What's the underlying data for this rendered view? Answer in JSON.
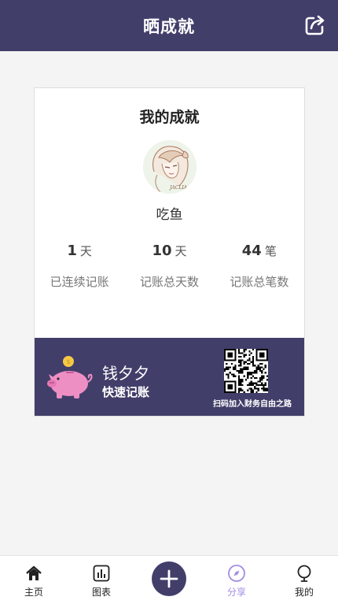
{
  "header": {
    "title": "晒成就",
    "share_icon": "share-icon"
  },
  "card": {
    "title": "我的成就",
    "username": "吃鱼",
    "stats": [
      {
        "value": "1",
        "unit": "天",
        "label": "已连续记账"
      },
      {
        "value": "10",
        "unit": "天",
        "label": "记账总天数"
      },
      {
        "value": "44",
        "unit": "笔",
        "label": "记账总笔数"
      }
    ]
  },
  "promo": {
    "brand_name": "钱夕夕",
    "slogan": "快速记账",
    "qr_caption": "扫码加入财务自由之路",
    "avatar_signature": "JACLIA"
  },
  "tabbar": {
    "items": [
      {
        "label": "主页",
        "icon": "home-icon"
      },
      {
        "label": "图表",
        "icon": "chart-icon"
      },
      {
        "label": "",
        "icon": "plus-icon"
      },
      {
        "label": "分享",
        "icon": "compass-icon"
      },
      {
        "label": "我的",
        "icon": "user-icon"
      }
    ],
    "active_index": 3
  },
  "colors": {
    "primary": "#423e6a",
    "active_tab": "#a38de2",
    "background": "#f4f4f4",
    "pig": "#ee8fc4",
    "coin": "#f6c945"
  }
}
